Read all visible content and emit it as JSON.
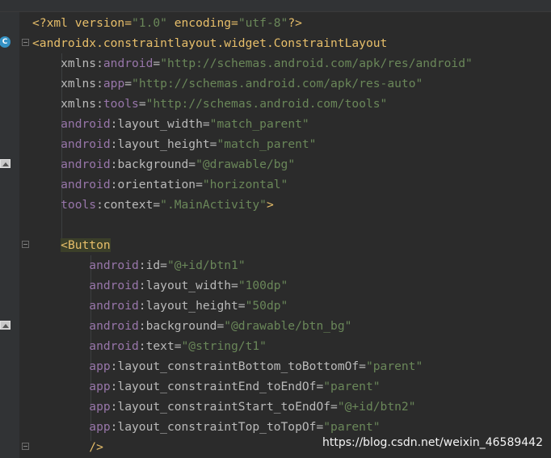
{
  "editor": {
    "lines": [
      [
        {
          "t": "<?xml version=",
          "c": "tag"
        },
        {
          "t": "\"1.0\"",
          "c": "str"
        },
        {
          "t": " encoding=",
          "c": "tag"
        },
        {
          "t": "\"utf-8\"",
          "c": "str"
        },
        {
          "t": "?>",
          "c": "tag"
        }
      ],
      [
        {
          "t": "<androidx.constraintlayout.widget.ConstraintLayout",
          "c": "tag"
        }
      ],
      [
        {
          "t": "    xmlns:",
          "c": "attr"
        },
        {
          "t": "android",
          "c": "ns"
        },
        {
          "t": "=",
          "c": "attr"
        },
        {
          "t": "\"http://schemas.android.com/apk/res/android\"",
          "c": "str"
        }
      ],
      [
        {
          "t": "    xmlns:",
          "c": "attr"
        },
        {
          "t": "app",
          "c": "ns"
        },
        {
          "t": "=",
          "c": "attr"
        },
        {
          "t": "\"http://schemas.android.com/apk/res-auto\"",
          "c": "str"
        }
      ],
      [
        {
          "t": "    xmlns:",
          "c": "attr"
        },
        {
          "t": "tools",
          "c": "ns"
        },
        {
          "t": "=",
          "c": "attr"
        },
        {
          "t": "\"http://schemas.android.com/tools\"",
          "c": "str"
        }
      ],
      [
        {
          "t": "    android",
          "c": "ns"
        },
        {
          "t": ":layout_width=",
          "c": "attr"
        },
        {
          "t": "\"match_parent\"",
          "c": "str"
        }
      ],
      [
        {
          "t": "    android",
          "c": "ns"
        },
        {
          "t": ":layout_height=",
          "c": "attr"
        },
        {
          "t": "\"match_parent\"",
          "c": "str"
        }
      ],
      [
        {
          "t": "    android",
          "c": "ns"
        },
        {
          "t": ":background=",
          "c": "attr"
        },
        {
          "t": "\"@drawable/bg\"",
          "c": "str"
        }
      ],
      [
        {
          "t": "    android",
          "c": "ns"
        },
        {
          "t": ":orientation=",
          "c": "attr"
        },
        {
          "t": "\"horizontal\"",
          "c": "str"
        }
      ],
      [
        {
          "t": "    tools",
          "c": "ns"
        },
        {
          "t": ":context=",
          "c": "attr"
        },
        {
          "t": "\".MainActivity\"",
          "c": "str"
        },
        {
          "t": ">",
          "c": "tag"
        }
      ],
      [],
      [
        {
          "t": "    ",
          "c": "attr"
        },
        {
          "t": "<Button",
          "c": "tag"
        }
      ],
      [
        {
          "t": "        android",
          "c": "ns"
        },
        {
          "t": ":id=",
          "c": "attr"
        },
        {
          "t": "\"@+id/btn1\"",
          "c": "str"
        }
      ],
      [
        {
          "t": "        android",
          "c": "ns"
        },
        {
          "t": ":layout_width=",
          "c": "attr"
        },
        {
          "t": "\"100dp\"",
          "c": "str"
        }
      ],
      [
        {
          "t": "        android",
          "c": "ns"
        },
        {
          "t": ":layout_height=",
          "c": "attr"
        },
        {
          "t": "\"50dp\"",
          "c": "str"
        }
      ],
      [
        {
          "t": "        android",
          "c": "ns"
        },
        {
          "t": ":background=",
          "c": "attr"
        },
        {
          "t": "\"@drawable/btn_bg\"",
          "c": "str"
        }
      ],
      [
        {
          "t": "        android",
          "c": "ns"
        },
        {
          "t": ":text=",
          "c": "attr"
        },
        {
          "t": "\"@string/t1\"",
          "c": "str"
        }
      ],
      [
        {
          "t": "        app",
          "c": "ns"
        },
        {
          "t": ":layout_constraintBottom_toBottomOf=",
          "c": "attr"
        },
        {
          "t": "\"parent\"",
          "c": "str"
        }
      ],
      [
        {
          "t": "        app",
          "c": "ns"
        },
        {
          "t": ":layout_constraintEnd_toEndOf=",
          "c": "attr"
        },
        {
          "t": "\"parent\"",
          "c": "str"
        }
      ],
      [
        {
          "t": "        app",
          "c": "ns"
        },
        {
          "t": ":layout_constraintStart_toEndOf=",
          "c": "attr"
        },
        {
          "t": "\"@+id/btn2\"",
          "c": "str"
        }
      ],
      [
        {
          "t": "        app",
          "c": "ns"
        },
        {
          "t": ":layout_constraintTop_toTopOf=",
          "c": "attr"
        },
        {
          "t": "\"parent\"",
          "c": "str"
        }
      ],
      [
        {
          "t": "        />",
          "c": "tag"
        }
      ]
    ],
    "gutter_badge": "C"
  },
  "watermark": "https://blog.csdn.net/weixin_46589442",
  "colors": {
    "background": "#2b2b2b",
    "gutter": "#313335",
    "tag": "#e8bf6a",
    "namespace": "#9876aa",
    "attribute": "#bababa",
    "string": "#6a8759"
  }
}
